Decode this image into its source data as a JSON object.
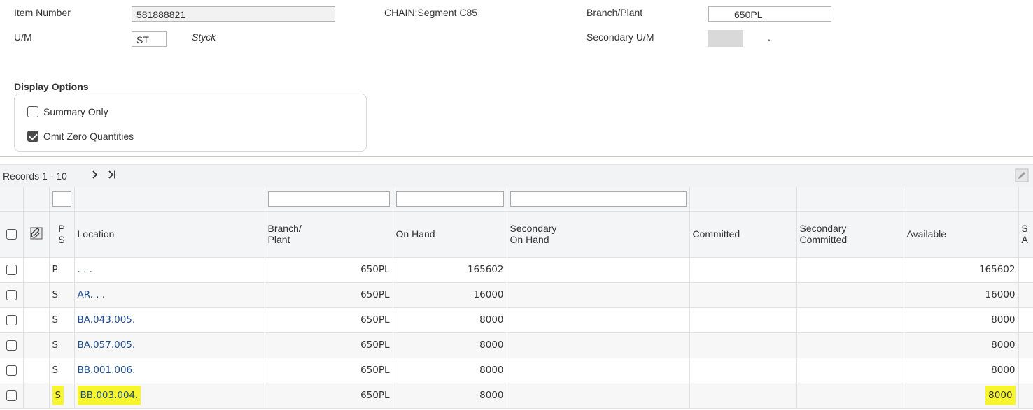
{
  "header": {
    "item_number_label": "Item Number",
    "item_number_value": "581888821",
    "description": "CHAIN;Segment C85",
    "branch_plant_label": "Branch/Plant",
    "branch_plant_value": "650PL",
    "um_label": "U/M",
    "um_value": "ST",
    "um_description": "Styck",
    "secondary_um_label": "Secondary U/M",
    "secondary_um_value": "."
  },
  "display_options": {
    "title": "Display Options",
    "summary_only": {
      "label": "Summary Only",
      "checked": false
    },
    "omit_zero": {
      "label": "Omit Zero Quantities",
      "checked": true
    }
  },
  "grid": {
    "records_label": "Records 1 - 10",
    "next_icon": "chevron-right-icon",
    "last_icon": "last-page-icon",
    "columns": {
      "ps_line1": "P",
      "ps_line2": "S",
      "location": "Location",
      "branch_line1": "Branch/",
      "branch_line2": "Plant",
      "on_hand": "On Hand",
      "sec_on_hand_line1": "Secondary",
      "sec_on_hand_line2": "On Hand",
      "committed": "Committed",
      "sec_committed_line1": "Secondary",
      "sec_committed_line2": "Committed",
      "available": "Available",
      "sec_avail_line1": "S",
      "sec_avail_line2": "A"
    },
    "rows": [
      {
        "ps": "P",
        "location": ".   .   .",
        "branch": "650PL",
        "on_hand": "165602",
        "available": "165602",
        "highlight": false
      },
      {
        "ps": "S",
        "location": "AR.   .   .",
        "branch": "650PL",
        "on_hand": "16000",
        "available": "16000",
        "highlight": false
      },
      {
        "ps": "S",
        "location": "BA.043.005.",
        "branch": "650PL",
        "on_hand": "8000",
        "available": "8000",
        "highlight": false
      },
      {
        "ps": "S",
        "location": "BA.057.005.",
        "branch": "650PL",
        "on_hand": "8000",
        "available": "8000",
        "highlight": false
      },
      {
        "ps": "S",
        "location": "BB.001.006.",
        "branch": "650PL",
        "on_hand": "8000",
        "available": "8000",
        "highlight": false
      },
      {
        "ps": "S",
        "location": "BB.003.004.",
        "branch": "650PL",
        "on_hand": "8000",
        "available": "8000",
        "highlight": true
      }
    ],
    "highlight_color": "#f7f52e",
    "link_color": "#1f4e8c"
  }
}
